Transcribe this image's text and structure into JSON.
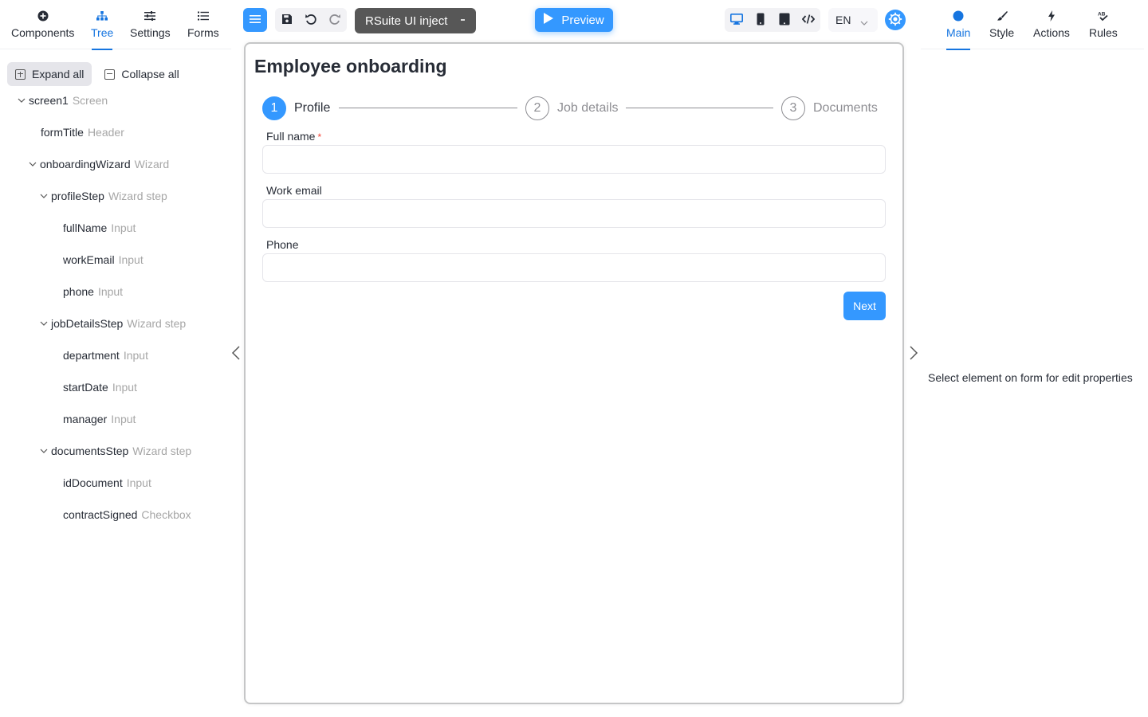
{
  "left_tabs": [
    {
      "label": "Components",
      "icon": "plus-circle-icon"
    },
    {
      "label": "Tree",
      "icon": "tree-icon",
      "active": true
    },
    {
      "label": "Settings",
      "icon": "sliders-icon"
    },
    {
      "label": "Forms",
      "icon": "list-icon"
    }
  ],
  "tree_actions": {
    "expand": "Expand all",
    "collapse": "Collapse all"
  },
  "tree": [
    {
      "name": "screen1",
      "type": "Screen"
    },
    {
      "name": "formTitle",
      "type": "Header"
    },
    {
      "name": "onboardingWizard",
      "type": "Wizard"
    },
    {
      "name": "profileStep",
      "type": "Wizard step"
    },
    {
      "name": "fullName",
      "type": "Input"
    },
    {
      "name": "workEmail",
      "type": "Input"
    },
    {
      "name": "phone",
      "type": "Input"
    },
    {
      "name": "jobDetailsStep",
      "type": "Wizard step"
    },
    {
      "name": "department",
      "type": "Input"
    },
    {
      "name": "startDate",
      "type": "Input"
    },
    {
      "name": "manager",
      "type": "Input"
    },
    {
      "name": "documentsStep",
      "type": "Wizard step"
    },
    {
      "name": "idDocument",
      "type": "Input"
    },
    {
      "name": "contractSigned",
      "type": "Checkbox"
    }
  ],
  "toolbar": {
    "form_selector": "RSuite UI inject",
    "preview_label": "Preview",
    "language": "EN"
  },
  "form": {
    "title": "Employee onboarding",
    "steps": [
      {
        "number": "1",
        "title": "Profile",
        "active": true
      },
      {
        "number": "2",
        "title": "Job details"
      },
      {
        "number": "3",
        "title": "Documents"
      }
    ],
    "fields": [
      {
        "label": "Full name",
        "required": "*",
        "value": ""
      },
      {
        "label": "Work email",
        "value": ""
      },
      {
        "label": "Phone",
        "value": ""
      }
    ],
    "next_label": "Next"
  },
  "right_tabs": [
    {
      "label": "Main",
      "icon": "circle-icon",
      "active": true
    },
    {
      "label": "Style",
      "icon": "brush-icon"
    },
    {
      "label": "Actions",
      "icon": "bolt-icon"
    },
    {
      "label": "Rules",
      "icon": "ab-icon"
    }
  ],
  "properties_hint": "Select element on form for edit properties",
  "colors": {
    "accent": "#3498ff",
    "accent_text": "#1675e0",
    "dark_select": "#575757"
  }
}
